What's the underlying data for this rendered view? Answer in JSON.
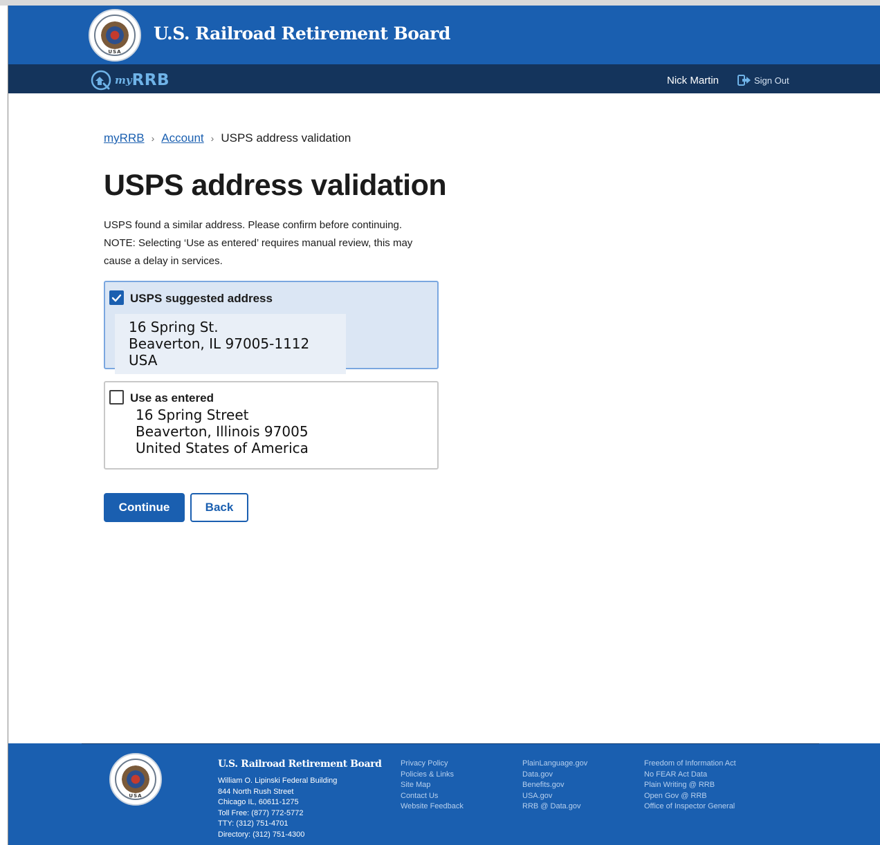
{
  "header": {
    "org_title": "U.S. Railroad Retirement Board",
    "seal_text": "USA",
    "app_logo_prefix": "my",
    "app_logo_name": "RRB",
    "user_name": "Nick Martin",
    "sign_out_label": "Sign Out"
  },
  "breadcrumb": {
    "items": [
      "myRRB",
      "Account"
    ],
    "current": "USPS address validation",
    "separator": "›"
  },
  "page": {
    "title": "USPS address validation",
    "intro_lines": [
      "USPS found a similar address. Please confirm before continuing.",
      "NOTE: Selecting ‘Use as entered’ requires manual review, this may",
      "cause a delay in services."
    ]
  },
  "options": [
    {
      "label": "USPS suggested address",
      "checked": true,
      "address_lines": [
        "16 Spring St.",
        "Beaverton, IL 97005-1112",
        "USA"
      ]
    },
    {
      "label": "Use as entered",
      "checked": false,
      "address_lines": [
        "16 Spring Street",
        "Beaverton, Illinois 97005",
        "United States of America"
      ]
    }
  ],
  "buttons": {
    "continue_label": "Continue",
    "back_label": "Back"
  },
  "footer": {
    "org_title": "U.S. Railroad Retirement Board",
    "address_lines": [
      "William O. Lipinski Federal Building",
      "844 North Rush Street",
      "Chicago IL, 60611-1275",
      "Toll Free: (877) 772-5772",
      "TTY: (312) 751-4701",
      "Directory: (312) 751-4300"
    ],
    "links_col1": [
      "Privacy Policy",
      "Policies & Links",
      "Site Map",
      "Contact Us",
      "Website Feedback"
    ],
    "links_col2": [
      "PlainLanguage.gov",
      "Data.gov",
      "Benefits.gov",
      "USA.gov",
      "RRB @ Data.gov"
    ],
    "links_col3": [
      "Freedom of Information Act",
      "No FEAR Act Data",
      "Plain Writing @ RRB",
      "Open Gov @ RRB",
      "Office of Inspector General"
    ]
  },
  "colors": {
    "brand_blue": "#1a5fb0",
    "nav_dark": "#14345c",
    "selected_bg": "#dbe6f4"
  }
}
